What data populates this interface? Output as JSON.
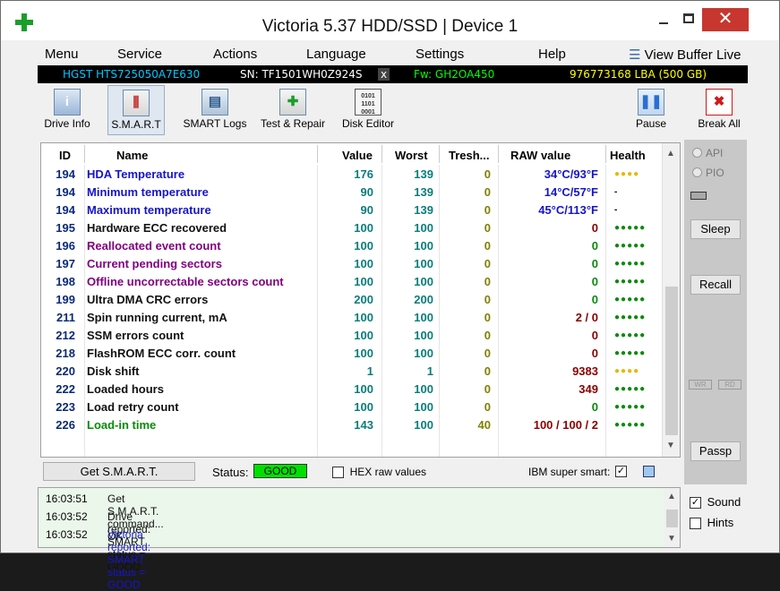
{
  "window": {
    "title": "Victoria 5.37 HDD/SSD | Device 1",
    "close_glyph": "✕"
  },
  "menu": [
    "Menu",
    "Service",
    "Actions",
    "Language",
    "Settings",
    "Help"
  ],
  "view_buffer": "View Buffer Live",
  "drive": {
    "model": "HGST HTS725050A7E630",
    "serial": "SN: TF1501WH0Z924S",
    "x": "x",
    "firmware": "Fw: GH2OA450",
    "lba": "976773168 LBA (500 GB)",
    "colors": {
      "model": "#00c8ff",
      "serial": "#ffffff",
      "firmware": "#00ff00",
      "lba": "#ffff00"
    }
  },
  "toolbar": {
    "drive_info": "Drive Info",
    "smart": "S.M.A.R.T",
    "smart_logs": "SMART Logs",
    "test_repair": "Test & Repair",
    "disk_editor": "Disk Editor",
    "pause": "Pause",
    "break_all": "Break All"
  },
  "columns": {
    "id": "ID",
    "name": "Name",
    "value": "Value",
    "worst": "Worst",
    "thresh": "Tresh...",
    "raw": "RAW value",
    "health": "Health"
  },
  "rows": [
    {
      "id": "194",
      "name": "HDA Temperature",
      "value": "176",
      "worst": "139",
      "thresh": "0",
      "raw": "34°C/93°F",
      "health": "●●●●",
      "name_color": "#1515c8",
      "raw_color": "#1515c8",
      "health_color": "#e6b800"
    },
    {
      "id": "194",
      "name": "Minimum temperature",
      "value": "90",
      "worst": "139",
      "thresh": "0",
      "raw": "14°C/57°F",
      "health": "-",
      "name_color": "#1515c8",
      "raw_color": "#1515c8",
      "health_color": "#000000"
    },
    {
      "id": "194",
      "name": "Maximum temperature",
      "value": "90",
      "worst": "139",
      "thresh": "0",
      "raw": "45°C/113°F",
      "health": "-",
      "name_color": "#1515c8",
      "raw_color": "#1515c8",
      "health_color": "#000000"
    },
    {
      "id": "195",
      "name": "Hardware ECC recovered",
      "value": "100",
      "worst": "100",
      "thresh": "0",
      "raw": "0",
      "health": "●●●●●",
      "name_color": "#111111",
      "raw_color": "#8b0000",
      "health_color": "#0a8a0a"
    },
    {
      "id": "196",
      "name": "Reallocated event count",
      "value": "100",
      "worst": "100",
      "thresh": "0",
      "raw": "0",
      "health": "●●●●●",
      "name_color": "#800080",
      "raw_color": "#0a8a0a",
      "health_color": "#0a8a0a"
    },
    {
      "id": "197",
      "name": "Current pending sectors",
      "value": "100",
      "worst": "100",
      "thresh": "0",
      "raw": "0",
      "health": "●●●●●",
      "name_color": "#800080",
      "raw_color": "#0a8a0a",
      "health_color": "#0a8a0a"
    },
    {
      "id": "198",
      "name": "Offline uncorrectable sectors count",
      "value": "100",
      "worst": "100",
      "thresh": "0",
      "raw": "0",
      "health": "●●●●●",
      "name_color": "#800080",
      "raw_color": "#0a8a0a",
      "health_color": "#0a8a0a"
    },
    {
      "id": "199",
      "name": "Ultra DMA CRC errors",
      "value": "200",
      "worst": "200",
      "thresh": "0",
      "raw": "0",
      "health": "●●●●●",
      "name_color": "#111111",
      "raw_color": "#0a8a0a",
      "health_color": "#0a8a0a"
    },
    {
      "id": "211",
      "name": "Spin running current, mA",
      "value": "100",
      "worst": "100",
      "thresh": "0",
      "raw": "2 / 0",
      "health": "●●●●●",
      "name_color": "#111111",
      "raw_color": "#8b0000",
      "health_color": "#0a8a0a"
    },
    {
      "id": "212",
      "name": "SSM errors count",
      "value": "100",
      "worst": "100",
      "thresh": "0",
      "raw": "0",
      "health": "●●●●●",
      "name_color": "#111111",
      "raw_color": "#8b0000",
      "health_color": "#0a8a0a"
    },
    {
      "id": "218",
      "name": "FlashROM ECC corr. count",
      "value": "100",
      "worst": "100",
      "thresh": "0",
      "raw": "0",
      "health": "●●●●●",
      "name_color": "#111111",
      "raw_color": "#8b0000",
      "health_color": "#0a8a0a"
    },
    {
      "id": "220",
      "name": "Disk shift",
      "value": "1",
      "worst": "1",
      "thresh": "0",
      "raw": "9383",
      "health": "●●●●",
      "name_color": "#111111",
      "raw_color": "#8b0000",
      "health_color": "#e6b800"
    },
    {
      "id": "222",
      "name": "Loaded hours",
      "value": "100",
      "worst": "100",
      "thresh": "0",
      "raw": "349",
      "health": "●●●●●",
      "name_color": "#111111",
      "raw_color": "#8b0000",
      "health_color": "#0a8a0a"
    },
    {
      "id": "223",
      "name": "Load retry count",
      "value": "100",
      "worst": "100",
      "thresh": "0",
      "raw": "0",
      "health": "●●●●●",
      "name_color": "#111111",
      "raw_color": "#0a8a0a",
      "health_color": "#0a8a0a"
    },
    {
      "id": "226",
      "name": "Load-in time",
      "value": "143",
      "worst": "100",
      "thresh": "40",
      "raw": "100 / 100 / 2",
      "health": "●●●●●",
      "name_color": "#0a8a0a",
      "raw_color": "#8b0000",
      "health_color": "#0a8a0a"
    }
  ],
  "status": {
    "get_smart": "Get S.M.A.R.T.",
    "status_label": "Status:",
    "status_value": "GOOD",
    "hex_label": "HEX raw values",
    "ibm_label": "IBM super smart:",
    "check": "✓"
  },
  "side": {
    "api": "API",
    "pio": "PIO",
    "sleep": "Sleep",
    "recall": "Recall",
    "wr": "WR",
    "rd": "RD",
    "passp": "Passp"
  },
  "log": [
    {
      "time": "16:03:51",
      "msg": "Get S.M.A.R.T. command... OK",
      "color": "#111111"
    },
    {
      "time": "16:03:52",
      "msg": "Drive reported: SMART status = GOOD",
      "color": "#111111"
    },
    {
      "time": "16:03:52",
      "msg": "Victoria reported: SMART status = GOOD",
      "color": "#1515c8"
    }
  ],
  "options": {
    "sound": "Sound",
    "sound_checked": true,
    "hints": "Hints",
    "hints_checked": false
  }
}
